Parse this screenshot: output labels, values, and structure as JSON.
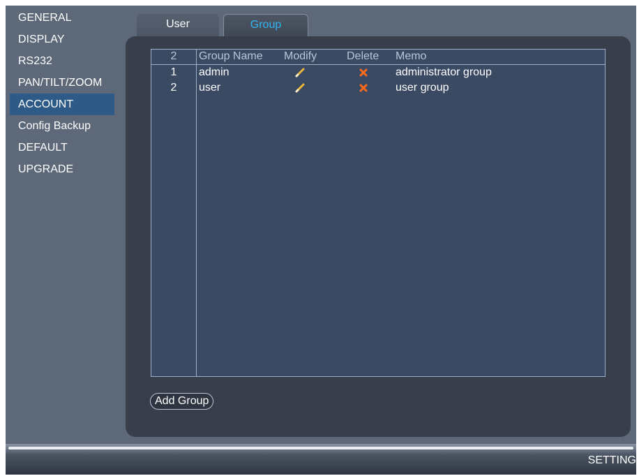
{
  "sidebar": {
    "items": [
      {
        "label": "GENERAL",
        "active": false
      },
      {
        "label": "DISPLAY",
        "active": false
      },
      {
        "label": "RS232",
        "active": false
      },
      {
        "label": "PAN/TILT/ZOOM",
        "active": false
      },
      {
        "label": "ACCOUNT",
        "active": true
      },
      {
        "label": "Config Backup",
        "active": false
      },
      {
        "label": "DEFAULT",
        "active": false
      },
      {
        "label": "UPGRADE",
        "active": false
      }
    ]
  },
  "tabs": [
    {
      "label": "User",
      "selected": false
    },
    {
      "label": "Group",
      "selected": true
    }
  ],
  "table": {
    "count_header": "2",
    "columns": [
      "Group Name",
      "Modify",
      "Delete",
      "Memo"
    ],
    "rows": [
      {
        "index": "1",
        "name": "admin",
        "modify_icon": "pencil-icon",
        "delete_icon": "close-icon",
        "memo": "administrator group"
      },
      {
        "index": "2",
        "name": "user",
        "modify_icon": "pencil-icon",
        "delete_icon": "close-icon",
        "memo": "user group"
      }
    ]
  },
  "add_group_label": "Add Group",
  "footer_label": "SETTING",
  "colors": {
    "accent": "#2fb6f2",
    "active_item": "#2d5a86",
    "panel": "#383f4a",
    "table_bg": "#3a4a63",
    "pencil": "#f0b43a",
    "delete": "#ff6a1a"
  }
}
